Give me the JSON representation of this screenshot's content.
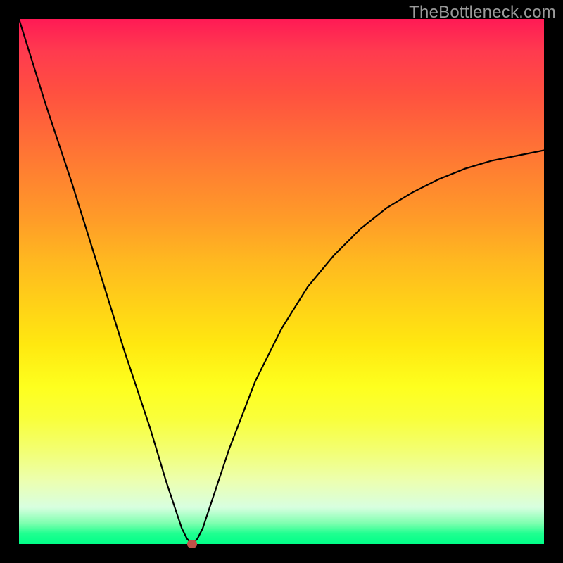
{
  "watermark": "TheBottleneck.com",
  "chart_data": {
    "type": "line",
    "title": "",
    "xlabel": "",
    "ylabel": "",
    "xlim": [
      0,
      100
    ],
    "ylim": [
      0,
      100
    ],
    "grid": false,
    "legend": false,
    "series": [
      {
        "name": "curve",
        "x": [
          0,
          5,
          10,
          15,
          20,
          25,
          28,
          30,
          31,
          32,
          33,
          34,
          35,
          37,
          40,
          45,
          50,
          55,
          60,
          65,
          70,
          75,
          80,
          85,
          90,
          95,
          100
        ],
        "y": [
          100,
          84,
          69,
          53,
          37,
          22,
          12,
          6,
          3,
          1,
          0,
          1,
          3,
          9,
          18,
          31,
          41,
          49,
          55,
          60,
          64,
          67,
          69.5,
          71.5,
          73,
          74,
          75
        ]
      }
    ],
    "marker": {
      "x": 33,
      "y": 0
    },
    "background_gradient": {
      "direction": "vertical",
      "stops": [
        {
          "pos": 0,
          "color": "#ff1a55"
        },
        {
          "pos": 50,
          "color": "#ffc81c"
        },
        {
          "pos": 75,
          "color": "#feff1e"
        },
        {
          "pos": 100,
          "color": "#00ff88"
        }
      ]
    }
  }
}
